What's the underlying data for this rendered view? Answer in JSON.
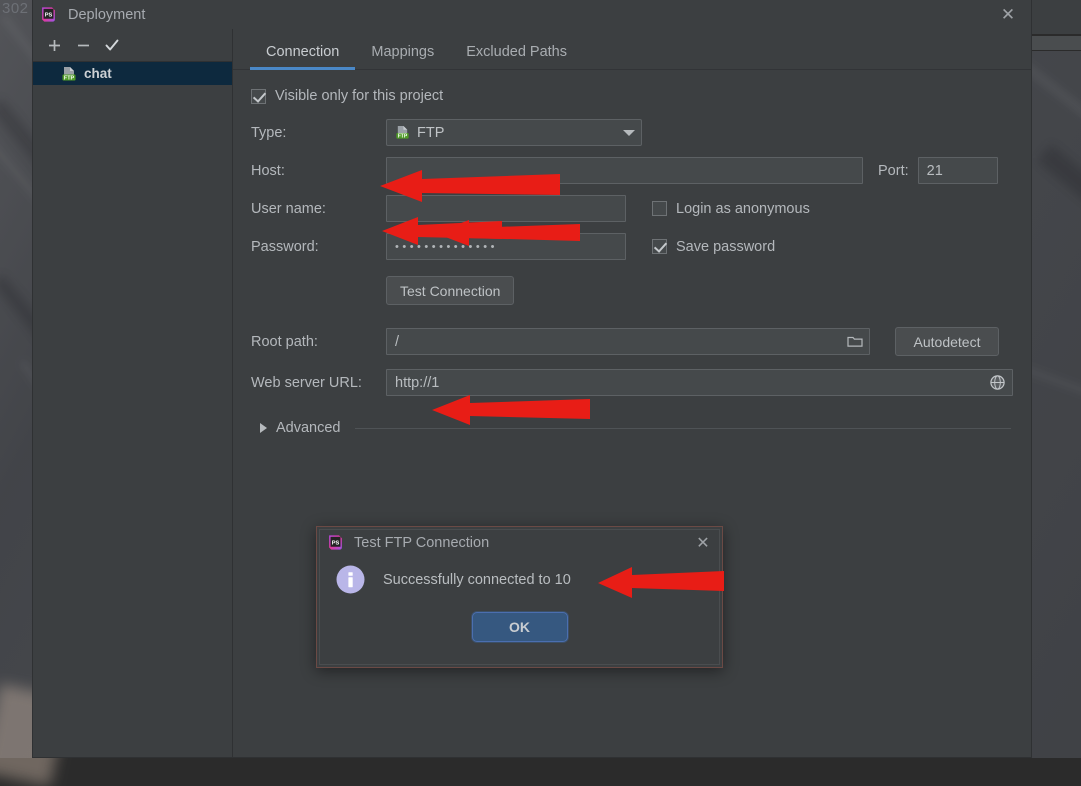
{
  "background": {
    "overlay_text": "302"
  },
  "dialog": {
    "title": "Deployment",
    "close_icon": "close-icon",
    "app_icon": "phpstorm-icon",
    "toolbar": {
      "add_label": "+",
      "remove_label": "−",
      "apply_label": "✓"
    },
    "servers": [
      {
        "name": "chat",
        "icon": "ftp-server-icon",
        "selected": true
      }
    ],
    "tabs": [
      {
        "label": "Connection",
        "active": true
      },
      {
        "label": "Mappings",
        "active": false
      },
      {
        "label": "Excluded Paths",
        "active": false
      }
    ],
    "form": {
      "visible_only_label": "Visible only for this project",
      "visible_only_checked": true,
      "type_label": "Type:",
      "type_value": "FTP",
      "host_label": "Host:",
      "host_value": "",
      "port_label": "Port:",
      "port_value": "21",
      "username_label": "User name:",
      "username_value": "",
      "login_anonymous_label": "Login as anonymous",
      "login_anonymous_checked": false,
      "password_label": "Password:",
      "password_value": "••••••••••••••",
      "save_password_label": "Save password",
      "save_password_checked": true,
      "test_connection_label": "Test Connection",
      "root_path_label": "Root path:",
      "root_path_value": "/",
      "autodetect_label": "Autodetect",
      "web_server_url_label": "Web server URL:",
      "web_server_url_value": "http://1",
      "advanced_label": "Advanced"
    }
  },
  "test_dialog": {
    "title": "Test FTP Connection",
    "app_icon": "phpstorm-icon",
    "close_icon": "close-icon",
    "status_icon": "info-icon",
    "message": "Successfully connected to 10",
    "ok_label": "OK"
  },
  "colors": {
    "accent_tab": "#4a88c7",
    "selection": "#0d293e",
    "ok_button": "#365880",
    "redaction_arrow": "#e81d16",
    "panel_bg": "#3c3f41",
    "field_bg": "#45494b"
  }
}
